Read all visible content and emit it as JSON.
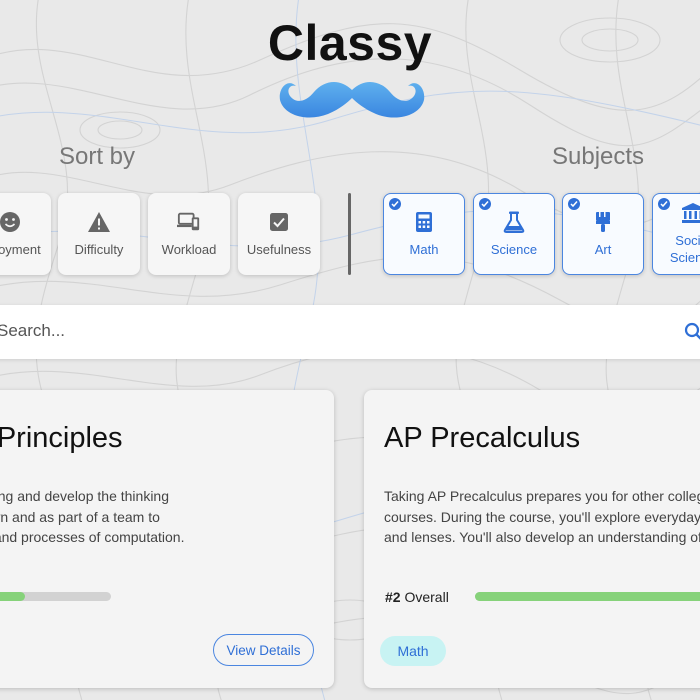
{
  "header": {
    "title": "Classy",
    "logo_icon": "mustache-icon",
    "accent_color": "#4b9be8"
  },
  "sort": {
    "label": "Sort by",
    "items": [
      {
        "label": "Enjoyment",
        "icon": "smiley-icon"
      },
      {
        "label": "Difficulty",
        "icon": "warning-icon"
      },
      {
        "label": "Workload",
        "icon": "devices-icon"
      },
      {
        "label": "Usefulness",
        "icon": "checkbox-icon"
      }
    ]
  },
  "subjects": {
    "label": "Subjects",
    "items": [
      {
        "label": "Math",
        "icon": "calculator-icon",
        "checked": true
      },
      {
        "label": "Science",
        "icon": "flask-icon",
        "checked": true
      },
      {
        "label": "Art",
        "icon": "paintbrush-icon",
        "checked": true
      },
      {
        "label": "Social Science",
        "icon": "institution-icon",
        "checked": true
      }
    ]
  },
  "search": {
    "placeholder": "Search..."
  },
  "cards": [
    {
      "title": "AP Computer Science Principles",
      "description_lines": [
        "Explore the foundational ideas of science of computing and develop the thinking",
        "skills computer scientists use. You'll work on your own and as part of a team to",
        "creatively address real-world issues using the tools and processes of computation."
      ],
      "progress": 0.55,
      "button_label": "View Details"
    },
    {
      "title": "AP Precalculus",
      "description_lines": [
        "Taking AP Precalculus prepares you for other college-level mathematics",
        "courses. During the course, you'll explore everyday situations using mathematical tools",
        "and lenses. You'll also develop an understanding of modeling and functions."
      ],
      "rank_number": "#2",
      "rank_label": "Overall",
      "progress": 0.9,
      "subject_label": "Math"
    }
  ]
}
